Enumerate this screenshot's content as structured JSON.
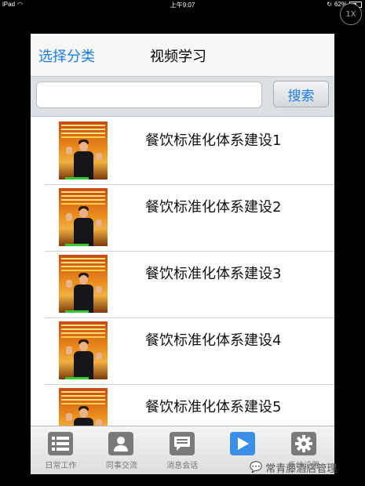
{
  "status_bar": {
    "device": "iPad",
    "time": "上午9:07",
    "battery": "62%",
    "battery_level": 0.62
  },
  "zoom_badge": "1X",
  "navbar": {
    "left_button": "选择分类",
    "title": "视频学习"
  },
  "search": {
    "value": "",
    "placeholder": "",
    "button": "搜索"
  },
  "videos": [
    {
      "title": "餐饮标准化体系建设1"
    },
    {
      "title": "餐饮标准化体系建设2"
    },
    {
      "title": "餐饮标准化体系建设3"
    },
    {
      "title": "餐饮标准化体系建设4"
    },
    {
      "title": "餐饮标准化体系建设5"
    }
  ],
  "tabbar": [
    {
      "label": "日常工作",
      "icon": "list-icon",
      "active": false
    },
    {
      "label": "同事交流",
      "icon": "person-icon",
      "active": false
    },
    {
      "label": "消息会话",
      "icon": "chat-icon",
      "active": false
    },
    {
      "label": "",
      "icon": "play-icon",
      "active": true
    },
    {
      "label": "系统设置",
      "icon": "gear-icon",
      "active": false
    }
  ],
  "watermark": "常青藤酒店管理",
  "colors": {
    "accent": "#1a7de0",
    "active_tab": "#3a8ee6",
    "inactive_tab": "#7a7a7a"
  }
}
